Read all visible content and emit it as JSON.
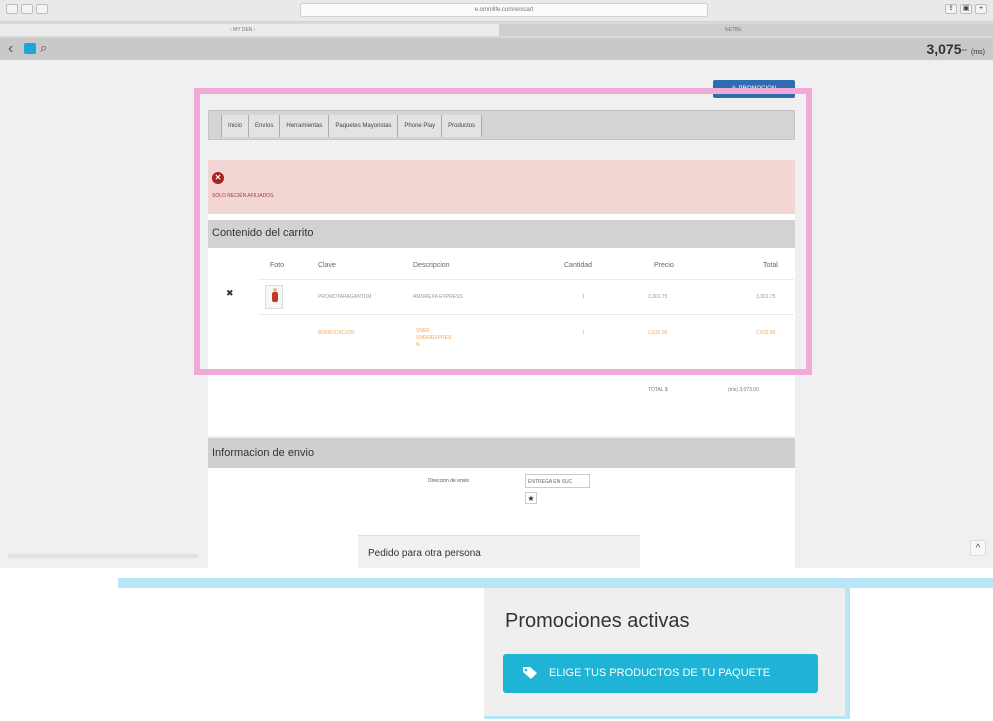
{
  "browser": {
    "address": "e.omnilife.com/en/cart",
    "tab_left": "‹ MY DEN ›",
    "tab_right": "NETBE"
  },
  "topbar": {
    "balance": "3,075",
    "balance_sup": "°°",
    "balance_unit": "(ms)"
  },
  "promo_button": "PROMOCION",
  "nav": [
    "Inicio",
    "Envíos",
    "Herramientas",
    "Paquetes Mayoristas",
    "Phone Play",
    "Productos"
  ],
  "alert": {
    "message": "SOLO RECIÉN AFILIADOS"
  },
  "cart": {
    "header": "Contenido del carrito",
    "columns": [
      "Foto",
      "Clave",
      "Descripcion",
      "Cantidad",
      "Precio",
      "Total"
    ],
    "rows": [
      {
        "clave": "PROMOTARAGANTUM",
        "descripcion": "AMOREXA EXPRESS",
        "cantidad": "1",
        "precio": "3,301.75",
        "total": "3,301.75"
      },
      {
        "clave": "BONIFICACION",
        "descripcion": "SNEK\nSNEK/EXPRES\nN",
        "cantidad": "1",
        "precio": "2,632.96",
        "total": "2,632.96"
      }
    ],
    "total_label": "TOTAL $",
    "total_value": "(ms) 3,073.00"
  },
  "shipping": {
    "header": "Informacion de envio",
    "label": "Direccion de envio",
    "select_value": "ENTREGA EN SUC",
    "other_person": "Pedido para otra persona"
  },
  "promotions": {
    "title": "Promociones activas",
    "button": "ELIGE TUS PRODUCTOS DE TU PAQUETE"
  }
}
